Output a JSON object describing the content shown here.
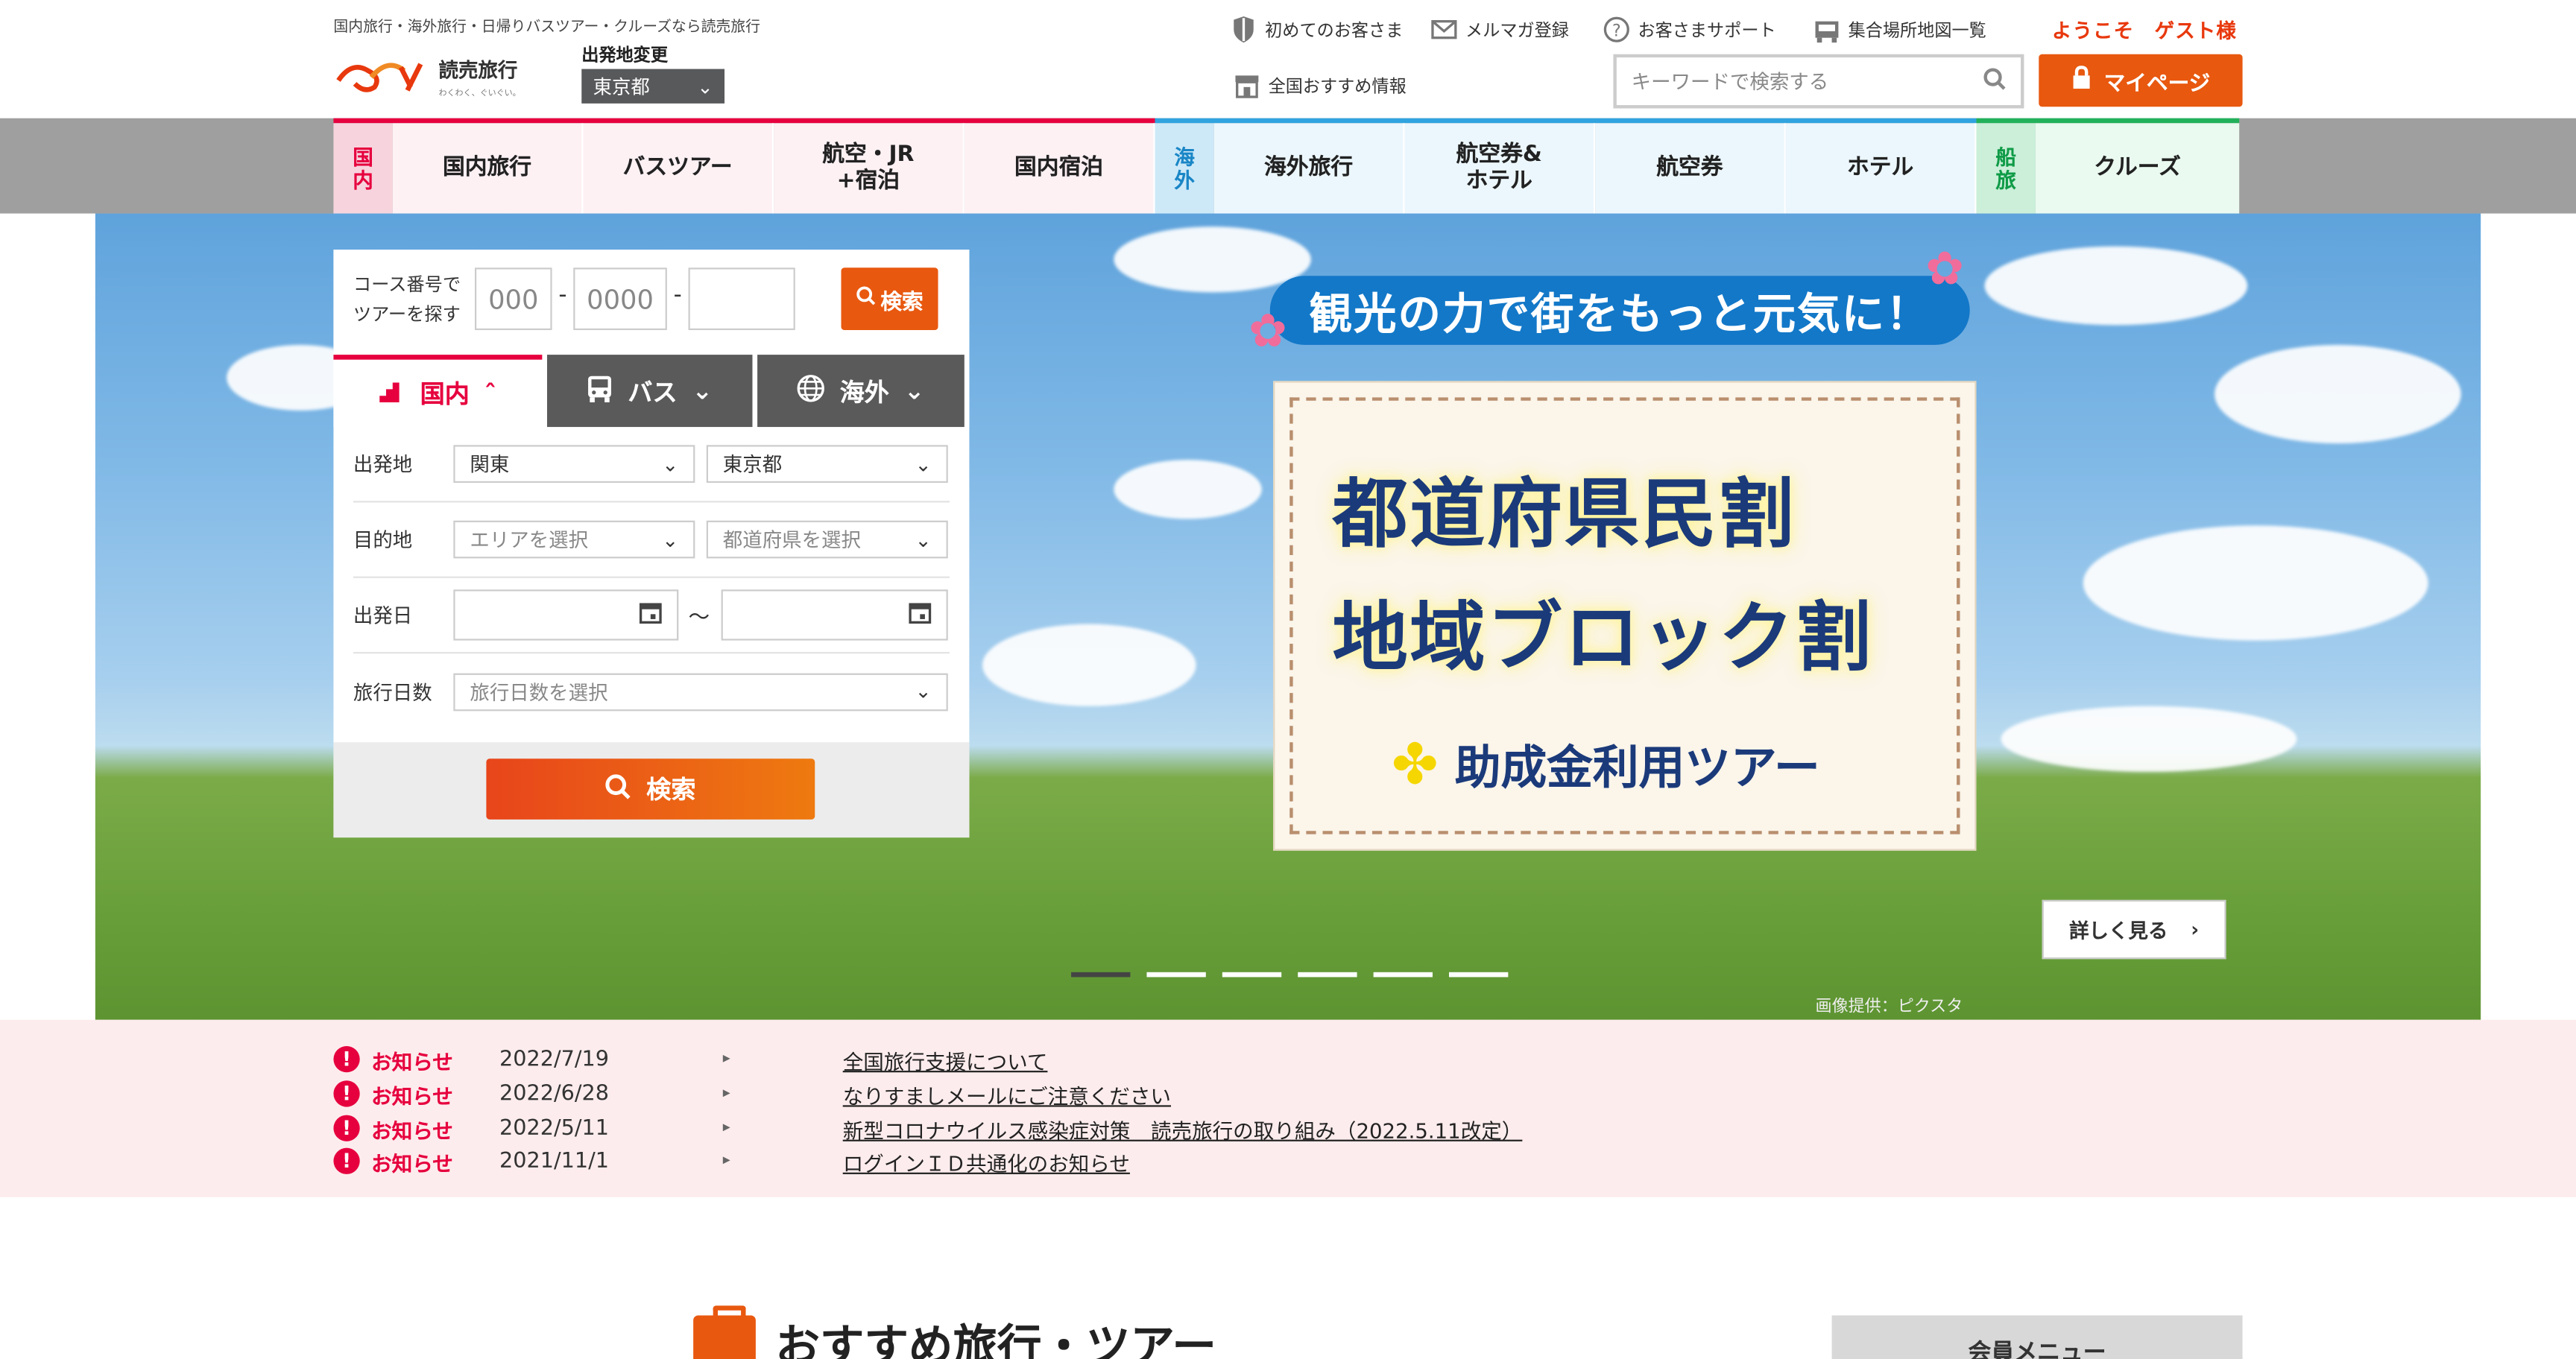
{
  "header": {
    "tagline": "国内旅行・海外旅行・日帰りバスツアー・クルーズなら読売旅行",
    "logo_text": "読売旅行",
    "logo_sub": "わくわく、ぐいぐい。",
    "departure_label": "出発地変更",
    "departure_value": "東京都",
    "utility_links": [
      {
        "label": "初めてのお客さま",
        "icon": "shield-icon"
      },
      {
        "label": "メルマガ登録",
        "icon": "mail-icon"
      },
      {
        "label": "お客さまサポート",
        "icon": "help-icon"
      },
      {
        "label": "集合場所地図一覧",
        "icon": "bus-stop-icon"
      },
      {
        "label": "全国おすすめ情報",
        "icon": "shop-icon"
      }
    ],
    "welcome": "ようこそ　ゲスト様",
    "search_placeholder": "キーワードで検索する",
    "mypage_label": "マイページ"
  },
  "nav": {
    "domestic_tag": "国内",
    "domestic_items": [
      "国内旅行",
      "バスツアー",
      "航空・JR\n+宿泊",
      "国内宿泊"
    ],
    "overseas_tag": "海外",
    "overseas_items": [
      "海外旅行",
      "航空券&\nホテル",
      "航空券",
      "ホテル"
    ],
    "cruise_tag": "船旅",
    "cruise_items": [
      "クルーズ"
    ]
  },
  "search_panel": {
    "course_label_1": "コース番号で",
    "course_label_2": "ツアーを探す",
    "course_inputs": [
      "000",
      "0000",
      ""
    ],
    "course_button": "検索",
    "tabs": [
      "国内",
      "バス",
      "海外"
    ],
    "rows": {
      "origin_label": "出発地",
      "origin_region": "関東",
      "origin_pref": "東京都",
      "dest_label": "目的地",
      "dest_area": "エリアを選択",
      "dest_pref": "都道府県を選択",
      "date_label": "出発日",
      "date_sep": "〜",
      "days_label": "旅行日数",
      "days_value": "旅行日数を選択"
    },
    "search_button": "検索"
  },
  "hero": {
    "headline": "観光の力で街をもっと元気に！",
    "card_line1": "都道府県民割",
    "card_line2": "地域ブロック割",
    "card_sub": "助成金利用ツアー",
    "detail_button": "詳しく見る",
    "credit": "画像提供：ピクスタ",
    "slide_count": 6,
    "active_slide": 1
  },
  "news": [
    {
      "label": "お知らせ",
      "date": "2022/7/19",
      "title": "全国旅行支援について"
    },
    {
      "label": "お知らせ",
      "date": "2022/6/28",
      "title": "なりすましメールにご注意ください"
    },
    {
      "label": "お知らせ",
      "date": "2022/5/11",
      "title": "新型コロナウイルス感染症対策　読売旅行の取り組み（2022.5.11改定）"
    },
    {
      "label": "お知らせ",
      "date": "2021/11/1",
      "title": "ログインＩＤ共通化のお知らせ"
    }
  ],
  "recommend_title": "おすすめ旅行・ツアー",
  "member_menu": "会員メニュー",
  "colors": {
    "accent": "#e8580f",
    "domestic": "#e6003e",
    "overseas": "#31a4df",
    "cruise": "#22b15a"
  }
}
